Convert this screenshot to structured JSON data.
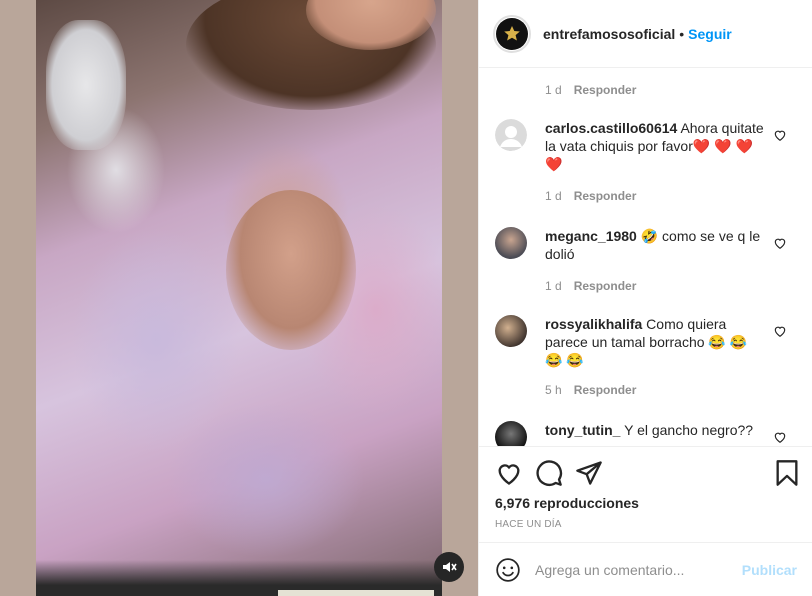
{
  "post": {
    "account": "entrefamososoficial",
    "separator": "•",
    "follow_label": "Seguir"
  },
  "comments": [
    {
      "username": "",
      "text": "",
      "time": "1 d",
      "reply_label": "Responder"
    },
    {
      "username": "carlos.castillo60614",
      "text": "Ahora quitate la vata chiquis por favor❤️ ❤️ ❤️ ❤️",
      "time": "1 d",
      "reply_label": "Responder"
    },
    {
      "username": "meganc_1980",
      "text": "🤣 como se ve q le dolió",
      "time": "1 d",
      "reply_label": "Responder"
    },
    {
      "username": "rossyalikhalifa",
      "text": "Como quiera parece un tamal borracho 😂 😂 😂 😂",
      "time": "5 h",
      "reply_label": "Responder"
    },
    {
      "username": "tony_tutin_",
      "text": "Y el gancho negro??",
      "time": "",
      "reply_label": ""
    }
  ],
  "stats": {
    "views": "6,976 reproducciones",
    "posted": "HACE UN DÍA"
  },
  "composer": {
    "placeholder": "Agrega un comentario...",
    "publish_label": "Publicar"
  },
  "colors": {
    "accent": "#0095f6",
    "publish_disabled": "#b2dffc",
    "muted_text": "#8e8e8e",
    "heart": "#ed4956"
  },
  "icons": {
    "mute": "speaker-muted-icon",
    "like": "heart-icon",
    "comment": "comment-bubble-icon",
    "share": "paper-plane-icon",
    "save": "bookmark-icon",
    "emoji": "smiley-icon"
  }
}
